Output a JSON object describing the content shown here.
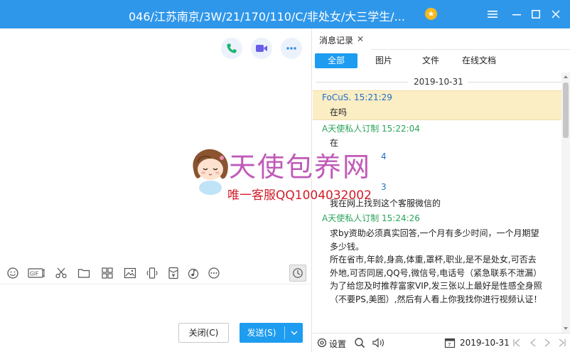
{
  "window": {
    "title": "046/江苏南京/3W/21/170/110/C/非处女/大三学生/...",
    "star": "★",
    "accent": "#2f97ea"
  },
  "chat_tools": {
    "call_icon": "phone-icon",
    "video_icon": "video-camera-icon",
    "more_icon": "more-dots-icon"
  },
  "toolbar": {
    "gif_label": "GIF",
    "icons": [
      "emoji-icon",
      "gif-icon",
      "scissors-icon",
      "folder-icon",
      "image-grid-icon",
      "picture-icon",
      "shake-icon",
      "red-packet-icon",
      "music-icon",
      "more-icon"
    ]
  },
  "footer_buttons": {
    "close_label": "关闭(C)",
    "send_label": "发送(S)"
  },
  "history": {
    "tab_label": "消息记录",
    "close_mark": "✕",
    "filters": [
      "全部",
      "图片",
      "文件",
      "在线文档"
    ],
    "date": "2019-10-31",
    "messages": [
      {
        "sender": "FoCuS. 15:21:29",
        "kind": "self",
        "text": "在吗"
      },
      {
        "sender": "A天使私人订制 15:22:04",
        "kind": "other",
        "text": "在"
      },
      {
        "sender": "4",
        "kind": "self",
        "text": "我在网上找到这个客服微信的"
      },
      {
        "sender": "A天使私人订制 15:24:26",
        "kind": "other",
        "text": "求by资助必须真实回答,一个月有多少时间，一个月期望多少钱。\n所在省市,年龄,身高,体重,罩杯,职业,是不是处女,可否去外地,可否同居,QQ号,微信号,电话号（紧急联系不泄漏）\n为了给您及时推荐富家VIP,发三张以上最好是性感全身照（不要PS,美图）,然后有人看上你我找你进行视频认证！"
      }
    ],
    "bottom": {
      "settings_label": "设置",
      "date_value": "2019-10-31"
    }
  },
  "watermark": {
    "title": "天使包养网",
    "subtitle": "唯一客服QQ1004032002"
  }
}
